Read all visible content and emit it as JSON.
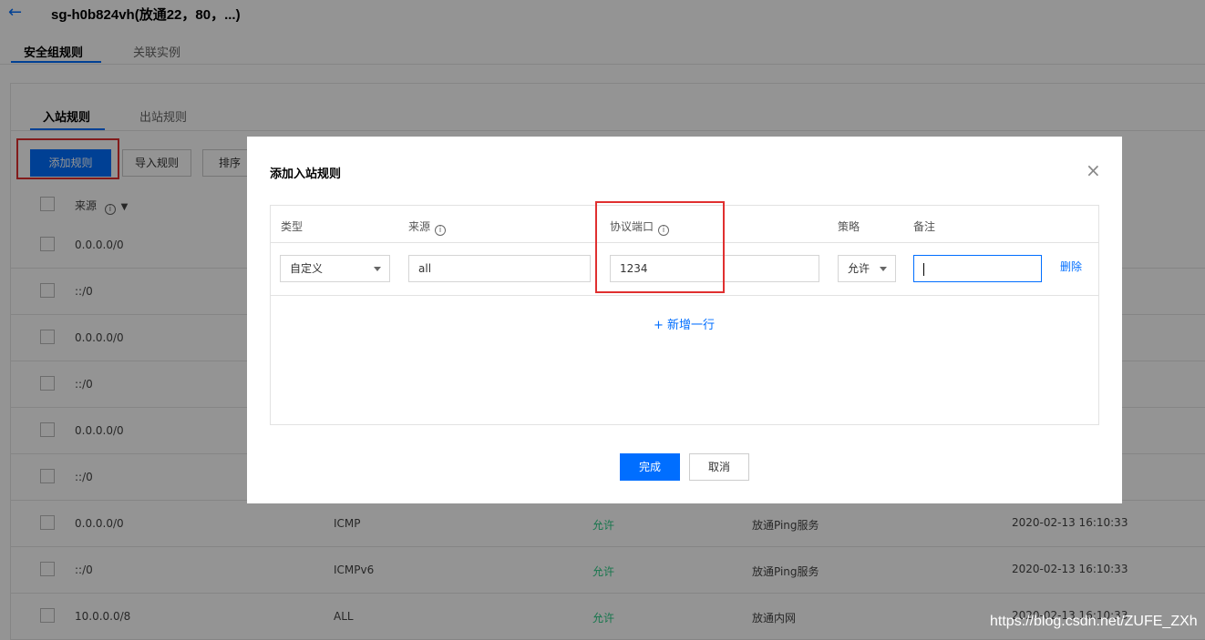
{
  "header": {
    "back_icon": "arrow-left-icon",
    "title": "sg-h0b824vh(放通22，80，...)"
  },
  "main_tabs": [
    {
      "label": "安全组规则",
      "active": true
    },
    {
      "label": "关联实例",
      "active": false
    }
  ],
  "sub_tabs": [
    {
      "label": "入站规则",
      "active": true
    },
    {
      "label": "出站规则",
      "active": false
    }
  ],
  "toolbar": {
    "add_rule": "添加规则",
    "import_rule": "导入规则",
    "sort": "排序"
  },
  "table": {
    "header": {
      "source": "来源",
      "info_icon": "ⓘ",
      "filter_icon": "▼"
    },
    "rows": [
      {
        "source": "0.0.0.0/0",
        "protocol": "",
        "policy": "",
        "note": "",
        "time": ""
      },
      {
        "source": "::/0",
        "protocol": "",
        "policy": "",
        "note": "",
        "time": ""
      },
      {
        "source": "0.0.0.0/0",
        "protocol": "",
        "policy": "",
        "note": "",
        "time": ""
      },
      {
        "source": "::/0",
        "protocol": "",
        "policy": "",
        "note": "",
        "time": ""
      },
      {
        "source": "0.0.0.0/0",
        "protocol": "",
        "policy": "",
        "note": "",
        "time": ""
      },
      {
        "source": "::/0",
        "protocol": "",
        "policy": "",
        "note": "",
        "time": ""
      },
      {
        "source": "0.0.0.0/0",
        "protocol": "ICMP",
        "policy": "允许",
        "note": "放通Ping服务",
        "time": "2020-02-13 16:10:33"
      },
      {
        "source": "::/0",
        "protocol": "ICMPv6",
        "policy": "允许",
        "note": "放通Ping服务",
        "time": "2020-02-13 16:10:33"
      },
      {
        "source": "10.0.0.0/8",
        "protocol": "ALL",
        "policy": "允许",
        "note": "放通内网",
        "time": "2020-02-13 16:10:33"
      }
    ]
  },
  "modal": {
    "title": "添加入站规则",
    "close_icon": "×",
    "columns": {
      "type": "类型",
      "source": "来源",
      "port": "协议端口",
      "policy": "策略",
      "note": "备注",
      "info_icon": "ⓘ"
    },
    "row": {
      "type": "自定义",
      "source": "all",
      "port": "1234",
      "policy": "允许",
      "note": "",
      "delete": "删除"
    },
    "add_row": "+ 新增一行",
    "confirm": "完成",
    "cancel": "取消"
  },
  "watermark": "https://blog.csdn.net/ZUFE_ZXh",
  "colors": {
    "accent": "#006eff",
    "highlight": "#e03030",
    "allow": "#29cc85"
  }
}
